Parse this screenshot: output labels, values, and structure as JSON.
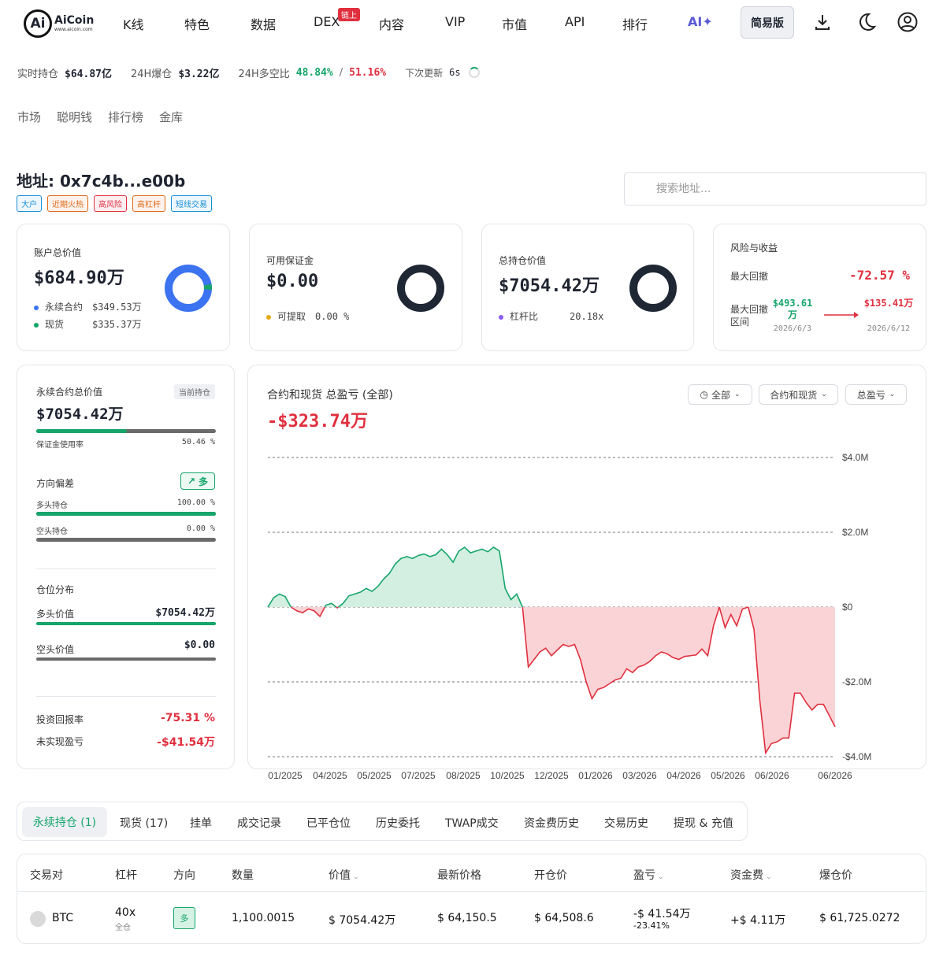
{
  "nav": {
    "logo_main": "AiCoin",
    "logo_sub": "www.aicoin.com",
    "items": [
      "K线",
      "特色",
      "数据",
      "DEX",
      "内容",
      "VIP",
      "市值",
      "API",
      "排行",
      "AI✦"
    ],
    "dex_badge": "链上",
    "simple_mode": "简易版"
  },
  "ticker": {
    "hold_label": "实时持仓",
    "hold_value": "$64.87亿",
    "liq_label": "24H爆仓",
    "liq_value": "$3.22亿",
    "ls_label": "24H多空比",
    "long_pct": "48.84%",
    "sep": "/",
    "short_pct": "51.16%",
    "next_label": "下次更新",
    "next_value": "6s"
  },
  "subnav": [
    "市场",
    "聪明钱",
    "排行榜",
    "金库"
  ],
  "address": {
    "title": "地址: 0x7c4b...e00b",
    "tags": [
      {
        "label": "大户",
        "color": "#1a8fd6"
      },
      {
        "label": "近期火热",
        "color": "#e06a1a"
      },
      {
        "label": "高风险",
        "color": "#e0303f"
      },
      {
        "label": "高杠杆",
        "color": "#e06a1a"
      },
      {
        "label": "短线交易",
        "color": "#1a8fd6"
      }
    ],
    "search_placeholder": "搜索地址..."
  },
  "cards": {
    "account": {
      "label": "账户总价值",
      "value": "$684.90万",
      "perp_label": "永续合约",
      "perp_value": "$349.53万",
      "spot_label": "现货",
      "spot_value": "$335.37万",
      "perp_color": "#3b73f0",
      "spot_color": "#16a56b",
      "spot_fraction": 0.04
    },
    "margin": {
      "label": "可用保证金",
      "value": "$0.00",
      "withdraw_label": "可提取",
      "withdraw_value": "0.00 %",
      "dot_color": "#e6a817"
    },
    "position": {
      "label": "总持仓价值",
      "value": "$7054.42万",
      "lev_label": "杠杆比",
      "lev_value": "20.18x",
      "dot_color": "#8b5cf6"
    },
    "risk": {
      "label": "风险与收益",
      "dd_label": "最大回撤",
      "dd_value": "-72.57 %",
      "range_label": "最大回撤 区间",
      "from_value": "$493.61万",
      "from_date": "2026/6/3",
      "to_value": "$135.41万",
      "to_date": "2026/6/12"
    }
  },
  "perp_panel": {
    "label": "永续合约总价值",
    "badge": "当前持仓",
    "value": "$7054.42万",
    "margin_label": "保证金使用率",
    "margin_value": "50.46 %",
    "margin_fraction": 0.5046,
    "bias_label": "方向偏差",
    "bias_badge": "多",
    "long_label": "多头持仓",
    "long_value": "100.00 %",
    "long_fraction": 1.0,
    "short_label": "空头持仓",
    "short_value": "0.00 %",
    "short_fraction": 0.0,
    "dist_label": "仓位分布",
    "long_val_label": "多头价值",
    "long_val": "$7054.42万",
    "short_val_label": "空头价值",
    "short_val": "$0.00",
    "roi_label": "投资回报率",
    "roi_value": "-75.31 %",
    "upnl_label": "未实现盈亏",
    "upnl_value": "-$41.54万"
  },
  "pnl_chart": {
    "title": "合约和现货 总盈亏 (全部)",
    "value": "-$323.74万",
    "filters": [
      "全部",
      "合约和现货",
      "总盈亏"
    ]
  },
  "chart_data": {
    "type": "area",
    "title": "合约和现货 总盈亏 (全部)",
    "x_ticks": [
      "01/2025",
      "04/2025",
      "05/2025",
      "07/2025",
      "08/2025",
      "10/2025",
      "12/2025",
      "01/2026",
      "03/2026",
      "04/2026",
      "05/2026",
      "06/2026",
      "06/2026"
    ],
    "y_ticks": [
      "$4.0M",
      "$2.0M",
      "$0",
      "-$2.0M",
      "-$4.0M"
    ],
    "ylim": [
      -4.0,
      4.0
    ],
    "y_unit": "M USD",
    "positive_color": "#16a56b",
    "negative_color": "#e0303f",
    "series": [
      {
        "values": [
          0,
          0.25,
          0.35,
          0.28,
          0,
          -0.1,
          -0.15,
          -0.05,
          -0.1,
          -0.25,
          0.05,
          0.1,
          -0.02,
          0.1,
          0.3,
          0.35,
          0.4,
          0.5,
          0.42,
          0.55,
          0.75,
          0.9,
          1.15,
          1.3,
          1.35,
          1.3,
          1.38,
          1.42,
          1.35,
          1.4,
          1.55,
          1.4,
          1.2,
          1.5,
          1.6,
          1.45,
          1.5,
          1.55,
          1.48,
          1.6,
          1.5,
          0.5,
          0.2,
          0.35,
          0,
          -1.6,
          -1.4,
          -1.2,
          -1.1,
          -1.3,
          -1.15,
          -1.0,
          -1.05,
          -1.0,
          -1.4,
          -2.0,
          -2.45,
          -2.2,
          -2.15,
          -2.05,
          -1.95,
          -1.9,
          -1.65,
          -1.75,
          -1.6,
          -1.55,
          -1.45,
          -1.3,
          -1.2,
          -1.25,
          -1.35,
          -1.4,
          -1.32,
          -1.3,
          -1.28,
          -1.12,
          -1.3,
          -0.5,
          0,
          -0.55,
          -0.2,
          -0.5,
          -0.05,
          0,
          -0.6,
          -2.5,
          -3.9,
          -3.65,
          -3.6,
          -3.5,
          -3.5,
          -2.3,
          -2.3,
          -2.55,
          -2.75,
          -2.6,
          -2.6,
          -2.9,
          -3.2
        ]
      }
    ]
  },
  "tabs": [
    "永续持仓 (1)",
    "现货 (17)",
    "挂单",
    "成交记录",
    "已平仓位",
    "历史委托",
    "TWAP成交",
    "资金费历史",
    "交易历史",
    "提现 & 充值"
  ],
  "table": {
    "headers": [
      "交易对",
      "杠杆",
      "方向",
      "数量",
      "价值",
      "最新价格",
      "开仓价",
      "盈亏",
      "资金费",
      "爆仓价"
    ],
    "row": {
      "pair": "BTC",
      "lev": "40x",
      "lev_mode": "全仓",
      "side": "多",
      "qty": "1,100.0015",
      "value": "$ 7054.42万",
      "last": "$ 64,150.5",
      "open": "$ 64,508.6",
      "pnl": "-$ 41.54万",
      "pnl_pct": "-23.41%",
      "funding": "+$ 4.11万",
      "liq": "$ 61,725.0272"
    }
  }
}
